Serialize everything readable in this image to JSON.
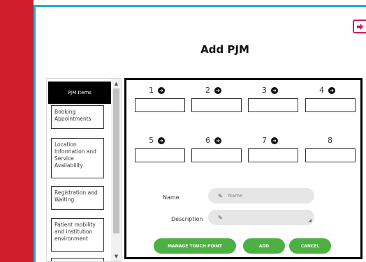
{
  "page": {
    "title": "Add PJM"
  },
  "icons": {
    "logout": "logout-arrow-icon",
    "slot_arrow": "arrow-circle-right-icon",
    "pencil": "pencil-icon"
  },
  "colors": {
    "sidebar": "#cf1f2d",
    "frame": "#26a8dd",
    "button": "#4cb043",
    "logout": "#cf1f5a"
  },
  "list": {
    "header": "PJM Items",
    "items": [
      "Booking Appointments",
      "Location Information and Service Availability",
      "Registration and Waiting",
      "Patient mobility and institution environment"
    ]
  },
  "slots": [
    {
      "number": "1",
      "arrow": true
    },
    {
      "number": "2",
      "arrow": true
    },
    {
      "number": "3",
      "arrow": true
    },
    {
      "number": "4",
      "arrow": true
    },
    {
      "number": "5",
      "arrow": true
    },
    {
      "number": "6",
      "arrow": true
    },
    {
      "number": "7",
      "arrow": true
    },
    {
      "number": "8",
      "arrow": false
    }
  ],
  "form": {
    "name_label": "Name",
    "name_placeholder": "Name",
    "description_label": "Description"
  },
  "buttons": {
    "manage": "MANAGE TOUCH POINT",
    "add": "ADD",
    "cancel": "CANCEL"
  }
}
